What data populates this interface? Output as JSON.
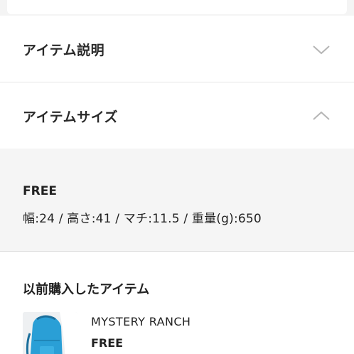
{
  "accordion": {
    "description_title": "アイテム説明",
    "size_title": "アイテムサイズ"
  },
  "size_panel": {
    "label": "FREE",
    "dimensions": "幅:24 / 高さ:41 / マチ:11.5 / 重量(g):650"
  },
  "previous_purchases": {
    "heading": "以前購入したアイテム",
    "items": [
      {
        "brand": "MYSTERY RANCH",
        "size": "FREE"
      }
    ]
  },
  "colors": {
    "panel_bg": "#f5f5f5",
    "chevron": "#b5b5b5",
    "product_accent": "#2a9fd6"
  }
}
